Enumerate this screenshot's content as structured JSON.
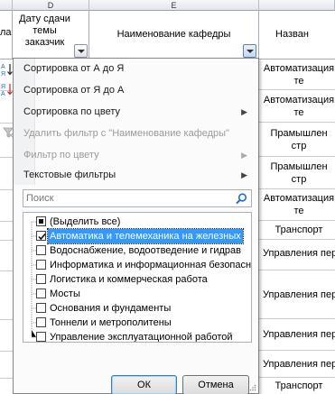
{
  "columns": {
    "letters": [
      "D",
      "E"
    ],
    "header_left_partial": "ла",
    "header_date": "Дату сдачи темы заказчик",
    "header_dept": "Наименование кафедры",
    "header_right_partial": "Назван"
  },
  "rows": [
    "Автоматизация",
    "Автоматизация",
    "Прамышлен",
    "Прамышлен",
    "Автоматизация",
    "Транспорт",
    "Управления пер",
    "Управления пер",
    "Управления пер",
    "Управления пер",
    "Транспорт"
  ],
  "rows_second_line": [
    "те",
    "те",
    "стр",
    "стр",
    "те",
    "",
    "",
    "",
    "",
    "",
    ""
  ],
  "menu": {
    "sort_asc": "Сортировка от А до Я",
    "sort_desc": "Сортировка от Я до А",
    "sort_color": "Сортировка по цвету",
    "clear_filter": "Удалить фильтр с \"Наименование кафедры\"",
    "filter_color": "Фильтр по цвету",
    "text_filters": "Текстовые фильтры"
  },
  "search": {
    "placeholder": "Поиск"
  },
  "list": {
    "select_all": "(Выделить все)",
    "items": [
      "Автоматика и телемеханика на железных",
      "Водоснабжение, водоотведение и гидрав",
      "Информатика и информационная безопасн",
      "Логистика и коммерческая работа",
      "Мосты",
      "Основания и фундаменты",
      "Тоннели и метрополитены",
      "Управление эксплуатационной работой"
    ],
    "checked": [
      true,
      false,
      false,
      false,
      false,
      false,
      false,
      false
    ]
  },
  "buttons": {
    "ok": "ОК",
    "cancel": "Отмена"
  },
  "icons": {
    "sort_asc": "sort-asc-icon",
    "sort_desc": "sort-desc-icon",
    "clear_filter": "clear-filter-icon",
    "search": "magnifier-icon",
    "dropdown": "dropdown-arrow-icon"
  },
  "colors": {
    "selection": "#3399ff",
    "accent": "#1e6fc5"
  }
}
